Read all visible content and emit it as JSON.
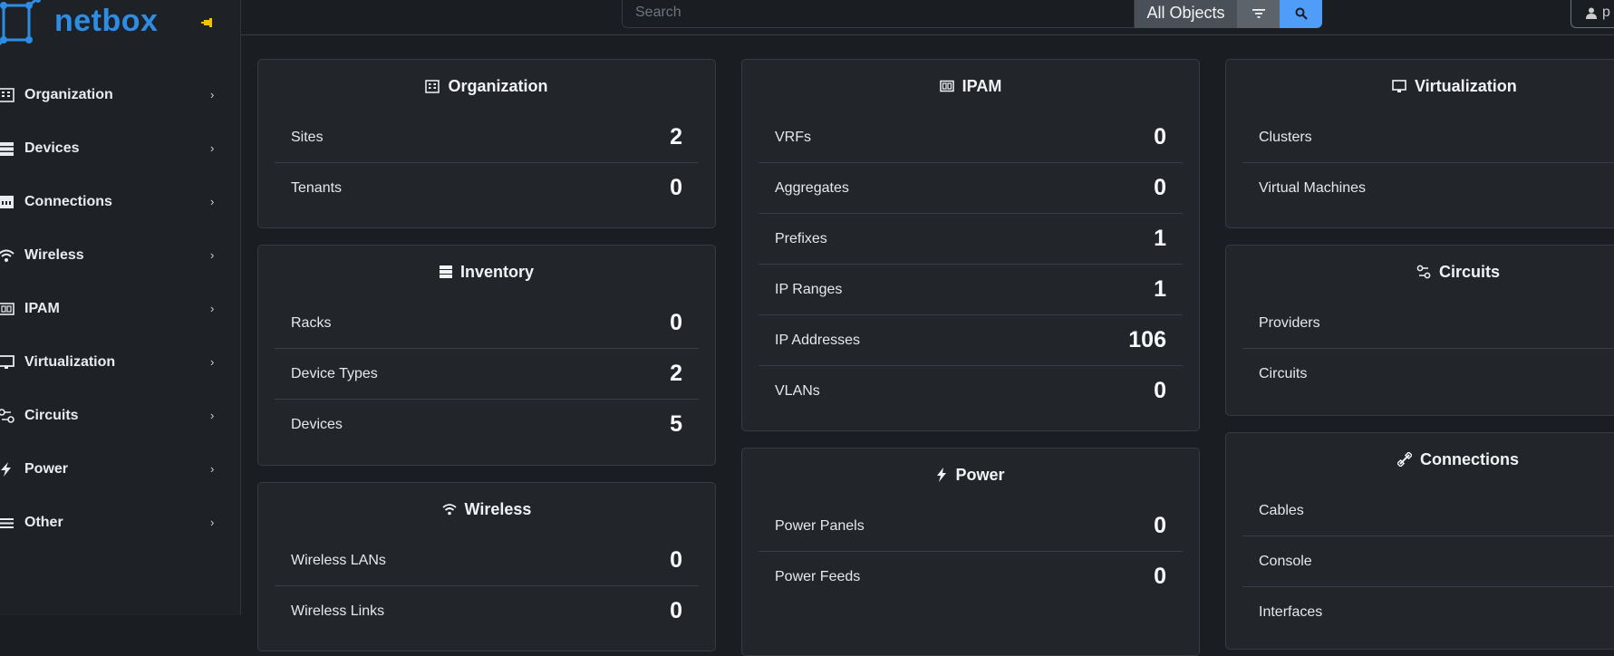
{
  "brand": {
    "name": "netbox"
  },
  "sidebar": {
    "items": [
      {
        "label": "Organization",
        "icon": "building-icon"
      },
      {
        "label": "Devices",
        "icon": "server-icon"
      },
      {
        "label": "Connections",
        "icon": "ethernet-icon"
      },
      {
        "label": "Wireless",
        "icon": "wifi-icon"
      },
      {
        "label": "IPAM",
        "icon": "counter-icon"
      },
      {
        "label": "Virtualization",
        "icon": "monitor-icon"
      },
      {
        "label": "Circuits",
        "icon": "transit-connection-icon"
      },
      {
        "label": "Power",
        "icon": "lightning-icon"
      },
      {
        "label": "Other",
        "icon": "menu-icon"
      }
    ],
    "chevron": "›"
  },
  "search": {
    "placeholder": "Search",
    "objects_label": "All Objects"
  },
  "user": {
    "initial": "p"
  },
  "cards": {
    "organization": {
      "title": "Organization",
      "rows": [
        {
          "label": "Sites",
          "count": "2"
        },
        {
          "label": "Tenants",
          "count": "0"
        }
      ]
    },
    "inventory": {
      "title": "Inventory",
      "rows": [
        {
          "label": "Racks",
          "count": "0"
        },
        {
          "label": "Device Types",
          "count": "2"
        },
        {
          "label": "Devices",
          "count": "5"
        }
      ]
    },
    "wireless": {
      "title": "Wireless",
      "rows": [
        {
          "label": "Wireless LANs",
          "count": "0"
        },
        {
          "label": "Wireless Links",
          "count": "0"
        }
      ]
    },
    "ipam": {
      "title": "IPAM",
      "rows": [
        {
          "label": "VRFs",
          "count": "0"
        },
        {
          "label": "Aggregates",
          "count": "0"
        },
        {
          "label": "Prefixes",
          "count": "1"
        },
        {
          "label": "IP Ranges",
          "count": "1"
        },
        {
          "label": "IP Addresses",
          "count": "106"
        },
        {
          "label": "VLANs",
          "count": "0"
        }
      ]
    },
    "power": {
      "title": "Power",
      "rows": [
        {
          "label": "Power Panels",
          "count": "0"
        },
        {
          "label": "Power Feeds",
          "count": "0"
        }
      ]
    },
    "virtualization": {
      "title": "Virtualization",
      "rows": [
        {
          "label": "Clusters",
          "count": ""
        },
        {
          "label": "Virtual Machines",
          "count": ""
        }
      ]
    },
    "circuits": {
      "title": "Circuits",
      "rows": [
        {
          "label": "Providers",
          "count": ""
        },
        {
          "label": "Circuits",
          "count": ""
        }
      ]
    },
    "connections": {
      "title": "Connections",
      "rows": [
        {
          "label": "Cables",
          "count": ""
        },
        {
          "label": "Console",
          "count": ""
        },
        {
          "label": "Interfaces",
          "count": ""
        }
      ]
    }
  },
  "colors": {
    "brand": "#2d8de4",
    "search_button": "#4f9cf9",
    "pin": "#f2c200"
  }
}
